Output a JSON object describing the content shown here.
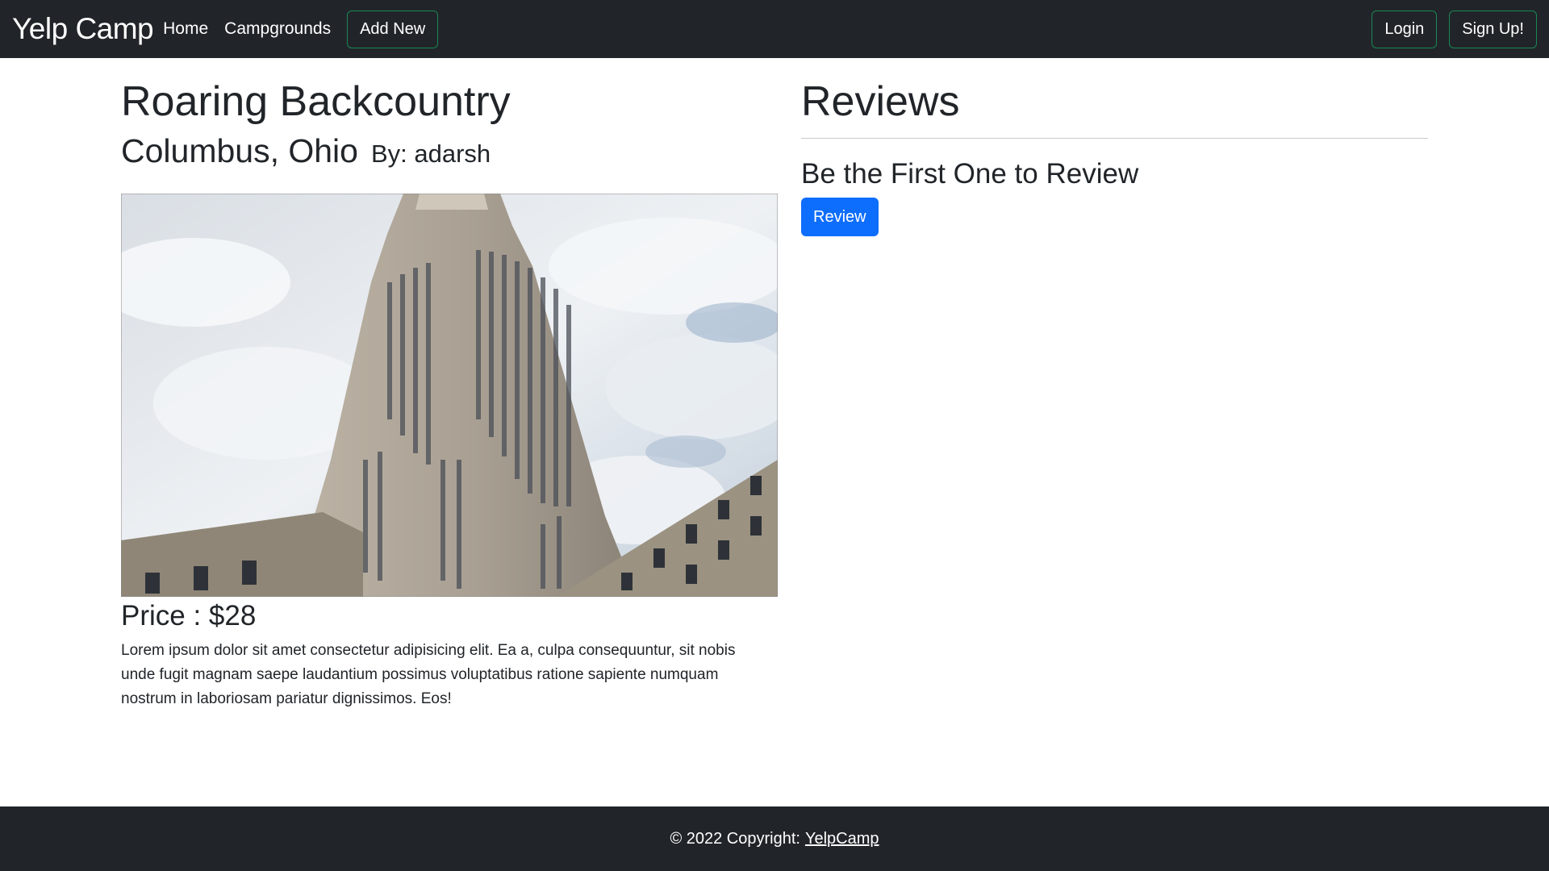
{
  "navbar": {
    "brand": "Yelp Camp",
    "links": [
      "Home",
      "Campgrounds"
    ],
    "add_new": "Add New",
    "login": "Login",
    "signup": "Sign Up!"
  },
  "campground": {
    "title": "Roaring Backcountry",
    "location": "Columbus, Ohio",
    "author": "By: adarsh",
    "price": "Price : $28",
    "description": "Lorem ipsum dolor sit amet consectetur adipisicing elit. Ea a, culpa consequuntur, sit nobis unde fugit magnam saepe laudantium possimus voluptatibus ratione sapiente numquam nostrum in laboriosam pariatur dignissimos. Eos!"
  },
  "reviews": {
    "title": "Reviews",
    "empty_message": "Be the First One to Review",
    "review_button": "Review"
  },
  "footer": {
    "copyright": "© 2022 Copyright:",
    "link": "YelpCamp"
  },
  "colors": {
    "dark": "#212529",
    "primary": "#0d6efd",
    "success_border": "#198754"
  }
}
